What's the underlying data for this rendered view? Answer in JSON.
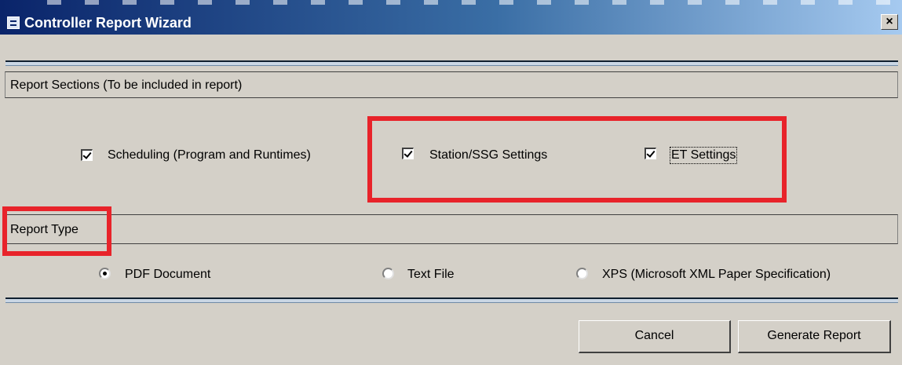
{
  "window": {
    "title": "Controller Report Wizard",
    "close_label": "×",
    "icon": "form-icon"
  },
  "report_sections": {
    "header": "Report Sections (To be included in report)",
    "items": [
      {
        "label": "Scheduling (Program and Runtimes)",
        "checked": true
      },
      {
        "label": "Station/SSG Settings",
        "checked": true
      },
      {
        "label": "ET Settings",
        "checked": true
      }
    ]
  },
  "report_type": {
    "header": "Report Type",
    "options": [
      {
        "label": "PDF Document",
        "selected": true
      },
      {
        "label": "Text File",
        "selected": false
      },
      {
        "label": "XPS (Microsoft XML Paper Specification)",
        "selected": false
      }
    ]
  },
  "buttons": {
    "cancel": "Cancel",
    "generate": "Generate Report"
  },
  "colors": {
    "title_bar": "#0a246a",
    "dialog_bg": "#d4d0c8",
    "annotation_highlight": "#e8232a"
  }
}
